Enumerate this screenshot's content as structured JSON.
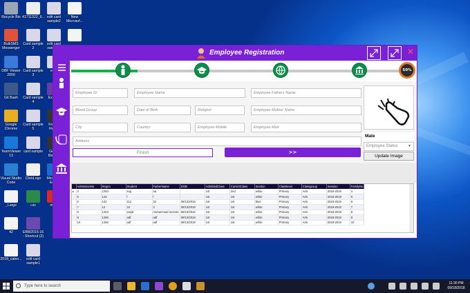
{
  "window": {
    "title": "Employee Registration"
  },
  "progress": {
    "percent_label": "50%",
    "fill_fraction": 0.2
  },
  "colors": {
    "accent": "#7a20d6",
    "step": "#0a8f4a",
    "header": "#140c3a"
  },
  "form": {
    "employee_id": "Employee ID",
    "employee_name": "Employee Name",
    "fathers_name": "Employee Fathers Name",
    "blood_group": "Blood Group",
    "date_of_birth": "Date of Birth",
    "religion": "Religion",
    "mother_name": "Employee Mother Name",
    "city": "City",
    "country": "Country",
    "mobile": "Employee Mobile",
    "mail": "Employee Mail",
    "address": "Address",
    "gender": "Male",
    "status_placeholder": "Employee Status",
    "finish_label": "Finish",
    "next_label": ">>",
    "update_image_label": "Update Image"
  },
  "table": {
    "columns": [
      "AdmissionNo",
      "Regno",
      "Student",
      "FatherName",
      "DOB",
      "AdmittedClass",
      "CurrentClass",
      "Section",
      "Classlevel",
      "Classgroup",
      "Session",
      "FamilyNo"
    ],
    "rows": [
      [
        "4",
        "1253",
        "sug",
        "aa",
        "",
        "1st",
        "2nd",
        "white",
        "Primary",
        "Arts",
        "2018-2019",
        "4"
      ],
      [
        "5",
        "123",
        "l",
        "l",
        "",
        "1st",
        "1st",
        "white",
        "Primary",
        "Arts",
        "2018-2019",
        "5"
      ],
      [
        "6",
        "122",
        "112",
        "22",
        "08/13/2018",
        "1st",
        "1st",
        "blue",
        "Primary",
        "Arts",
        "2018-2019",
        "6"
      ],
      [
        "7",
        "12",
        "22",
        "2",
        "08/13/2018",
        "1st",
        "1st",
        "white",
        "Primary",
        "Arts",
        "2018-2019",
        "7"
      ],
      [
        "8",
        "1253",
        "wajid",
        "muhammad ramzan",
        "08/13/2018",
        "1st",
        "1st",
        "white",
        "Primary",
        "Arts",
        "2018-2019",
        "8"
      ],
      [
        "9",
        "1256",
        "adf",
        "adf",
        "08/13/2018",
        "1st",
        "1st",
        "white",
        "Primary",
        "Arts",
        "2018-2019",
        "9"
      ],
      [
        "10",
        "1256",
        "adf",
        "adf",
        "08/13/2018",
        "1st",
        "1st",
        "white",
        "Primary",
        "Arts",
        "2018-2019",
        "10"
      ]
    ]
  },
  "desktop_icons": [
    {
      "label": "Recycle Bin",
      "color": "#9aa6b8"
    },
    {
      "label": "41711322_6...",
      "color": "#eeeeee"
    },
    {
      "label": "edit card\nsample2",
      "color": "#d8d8e8"
    },
    {
      "label": "New\nMicrosof...",
      "color": "#f4f4f4"
    },
    {
      "label": "BulkSMS\nMessenger",
      "color": "#e0533a"
    },
    {
      "label": "Card sample\n2",
      "color": "#d8d8e8"
    },
    {
      "label": "edit card\nsample3",
      "color": "#d8d8e8"
    },
    {
      "label": "",
      "color": "#f4f4f4"
    },
    {
      "label": "DBF Viewer\n2000",
      "color": "#3a7ad8"
    },
    {
      "label": "Card sample\n3",
      "color": "#d8d8e8"
    },
    {
      "label": "Git Bash",
      "color": "#3a5a8a"
    },
    {
      "label": "Card sample\n4",
      "color": "#d8d8e8"
    },
    {
      "label": "Google\nChrome",
      "color": "#e8b020"
    },
    {
      "label": "Card sample\n5",
      "color": "#d8d8e8"
    },
    {
      "label": "emp",
      "color": "#d8d8e8"
    },
    {
      "label": "TeamViewer\n13",
      "color": "#1a78d8"
    },
    {
      "label": "card sample",
      "color": "#d8d8e8"
    },
    {
      "label": "ExtraM",
      "color": "#6a3aa8"
    },
    {
      "label": "Visual Studio\nCode",
      "color": "#2a80d0"
    },
    {
      "label": "ClickLogo",
      "color": "#f0f0f0"
    },
    {
      "label": "Free S\nRecor",
      "color": "#333333"
    },
    {
      "label": "_Large",
      "color": "#f4f4f4"
    },
    {
      "label": "csv",
      "color": "#2a8a4a"
    },
    {
      "label": "Golde\nBank T",
      "color": "#333333"
    },
    {
      "label": "42",
      "color": "#f4f4f4"
    },
    {
      "label": "EBM2015-16\n- Shortcut (2)",
      "color": "#6a4ab0"
    },
    {
      "label": "Microsoft\nEdge",
      "color": "#1a6ad0"
    },
    {
      "label": "2018_calen...",
      "color": "#f4f4f4"
    },
    {
      "label": "edit card\nsample1",
      "color": "#d8d8e8"
    },
    {
      "label": "mpdf",
      "color": "#d82a2a"
    }
  ],
  "taskbar": {
    "search_placeholder": "Type here to search",
    "time": "11:30 PM",
    "date": "09/18/2018"
  }
}
